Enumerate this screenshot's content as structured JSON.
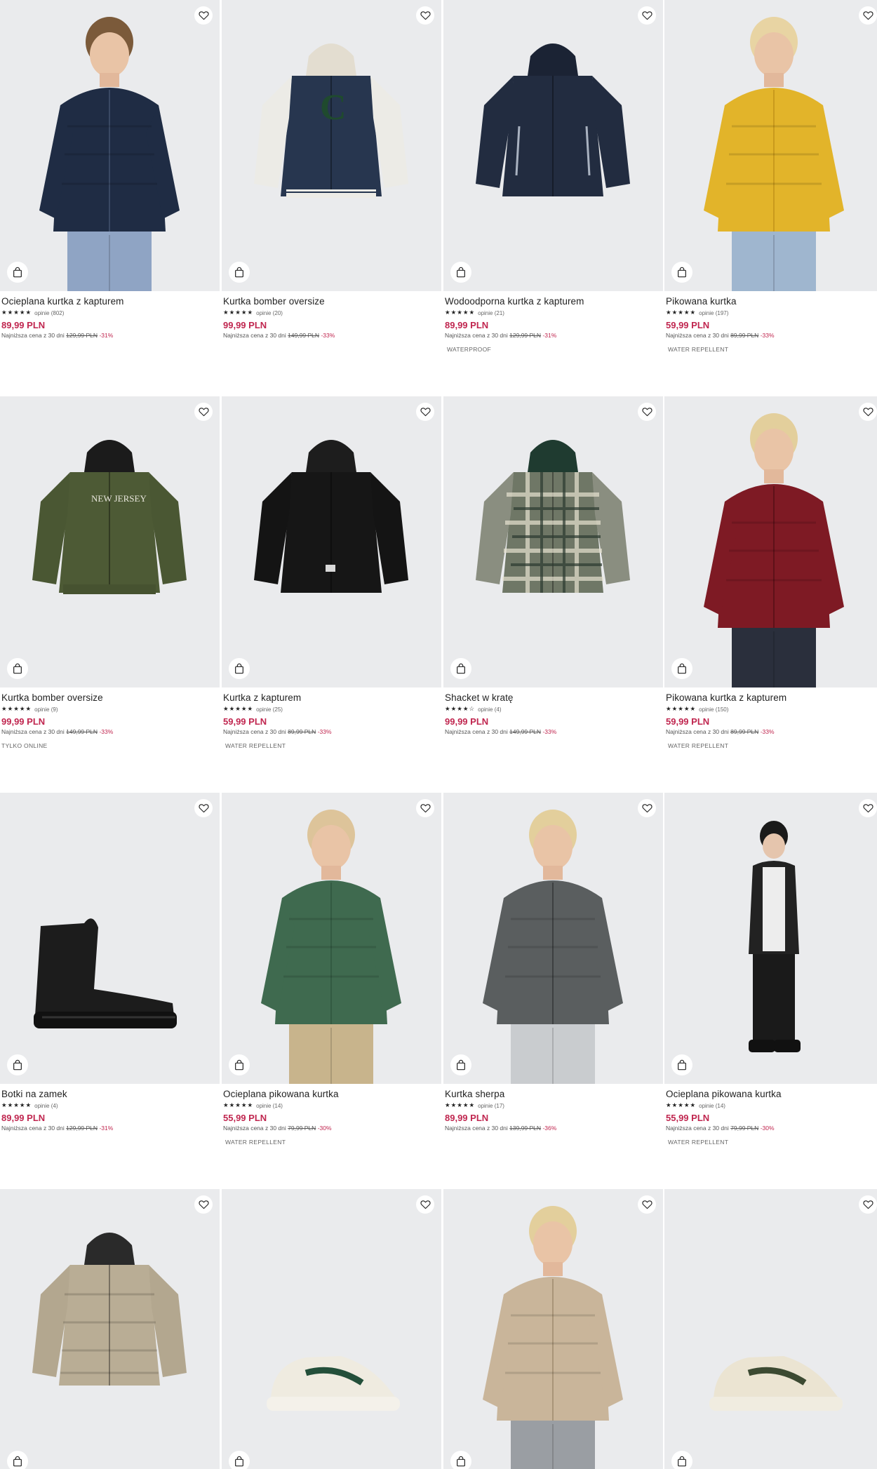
{
  "colors": {
    "price": "#c0264f",
    "image_bg": "#eaebed"
  },
  "icons": {
    "favorite": "heart-outline-icon",
    "cart": "shopping-bag-icon",
    "rating": "star-icon"
  },
  "products": [
    {
      "name": "Ocieplana kurtka z kapturem",
      "rating": 5,
      "reviews": "opinie (802)",
      "price": "89,99 PLN",
      "lowest_label": "Najniższa cena z 30 dni",
      "old_price": "129,99 PLN",
      "discount": "-31%",
      "tag": "",
      "art": "kid-navy-puffer"
    },
    {
      "name": "Kurtka bomber oversize",
      "rating": 5,
      "reviews": "opinie (20)",
      "price": "99,99 PLN",
      "lowest_label": "Najniższa cena z 30 dni",
      "old_price": "149,99 PLN",
      "discount": "-33%",
      "tag": "",
      "art": "varsity-bomber"
    },
    {
      "name": "Wodoodporna kurtka z kapturem",
      "rating": 5,
      "reviews": "opinie (21)",
      "price": "89,99 PLN",
      "lowest_label": "Najniższa cena z 30 dni",
      "old_price": "129,99 PLN",
      "discount": "-31%",
      "tag": "WATERPROOF",
      "art": "navy-rain-jacket"
    },
    {
      "name": "Pikowana kurtka",
      "rating": 5,
      "reviews": "opinie (197)",
      "price": "59,99 PLN",
      "lowest_label": "Najniższa cena z 30 dni",
      "old_price": "89,99 PLN",
      "discount": "-33%",
      "tag": "WATER REPELLENT",
      "art": "kid-yellow-puffer"
    },
    {
      "name": "Kurtka bomber oversize",
      "rating": 5,
      "reviews": "opinie (9)",
      "price": "99,99 PLN",
      "lowest_label": "Najniższa cena z 30 dni",
      "old_price": "149,99 PLN",
      "discount": "-33%",
      "tag": "TYLKO ONLINE",
      "art": "khaki-bomber"
    },
    {
      "name": "Kurtka z kapturem",
      "rating": 5,
      "reviews": "opinie (25)",
      "price": "59,99 PLN",
      "lowest_label": "Najniższa cena z 30 dni",
      "old_price": "89,99 PLN",
      "discount": "-33%",
      "tag": "WATER REPELLENT",
      "art": "black-hooded-jacket"
    },
    {
      "name": "Shacket w kratę",
      "rating": 4,
      "reviews": "opinie (4)",
      "price": "99,99 PLN",
      "lowest_label": "Najniższa cena z 30 dni",
      "old_price": "149,99 PLN",
      "discount": "-33%",
      "tag": "",
      "art": "plaid-shacket"
    },
    {
      "name": "Pikowana kurtka z kapturem",
      "rating": 5,
      "reviews": "opinie (150)",
      "price": "59,99 PLN",
      "lowest_label": "Najniższa cena z 30 dni",
      "old_price": "89,99 PLN",
      "discount": "-33%",
      "tag": "WATER REPELLENT",
      "art": "kid-red-puffer"
    },
    {
      "name": "Botki na zamek",
      "rating": 5,
      "reviews": "opinie (4)",
      "price": "89,99 PLN",
      "lowest_label": "Najniższa cena z 30 dni",
      "old_price": "129,99 PLN",
      "discount": "-31%",
      "tag": "",
      "art": "black-boot"
    },
    {
      "name": "Ocieplana pikowana kurtka",
      "rating": 5,
      "reviews": "opinie (14)",
      "price": "55,99 PLN",
      "lowest_label": "Najniższa cena z 30 dni",
      "old_price": "79,99 PLN",
      "discount": "-30%",
      "tag": "WATER REPELLENT",
      "art": "kid-green-puffer"
    },
    {
      "name": "Kurtka sherpa",
      "rating": 5,
      "reviews": "opinie (17)",
      "price": "89,99 PLN",
      "lowest_label": "Najniższa cena z 30 dni",
      "old_price": "139,99 PLN",
      "discount": "-36%",
      "tag": "",
      "art": "kid-grey-sherpa"
    },
    {
      "name": "Ocieplana pikowana kurtka",
      "rating": 5,
      "reviews": "opinie (14)",
      "price": "55,99 PLN",
      "lowest_label": "Najniższa cena z 30 dni",
      "old_price": "79,99 PLN",
      "discount": "-30%",
      "tag": "WATER REPELLENT",
      "art": "kid-black-puffer"
    },
    {
      "name": "",
      "rating": 0,
      "reviews": "",
      "price": "",
      "lowest_label": "",
      "old_price": "",
      "discount": "",
      "tag": "",
      "art": "beige-puffer"
    },
    {
      "name": "",
      "rating": 0,
      "reviews": "",
      "price": "",
      "lowest_label": "",
      "old_price": "",
      "discount": "",
      "tag": "",
      "art": "white-sneaker"
    },
    {
      "name": "",
      "rating": 0,
      "reviews": "",
      "price": "",
      "lowest_label": "",
      "old_price": "",
      "discount": "",
      "tag": "",
      "art": "kid-beige-vest"
    },
    {
      "name": "",
      "rating": 0,
      "reviews": "",
      "price": "",
      "lowest_label": "",
      "old_price": "",
      "discount": "",
      "tag": "",
      "art": "green-sneaker"
    }
  ]
}
